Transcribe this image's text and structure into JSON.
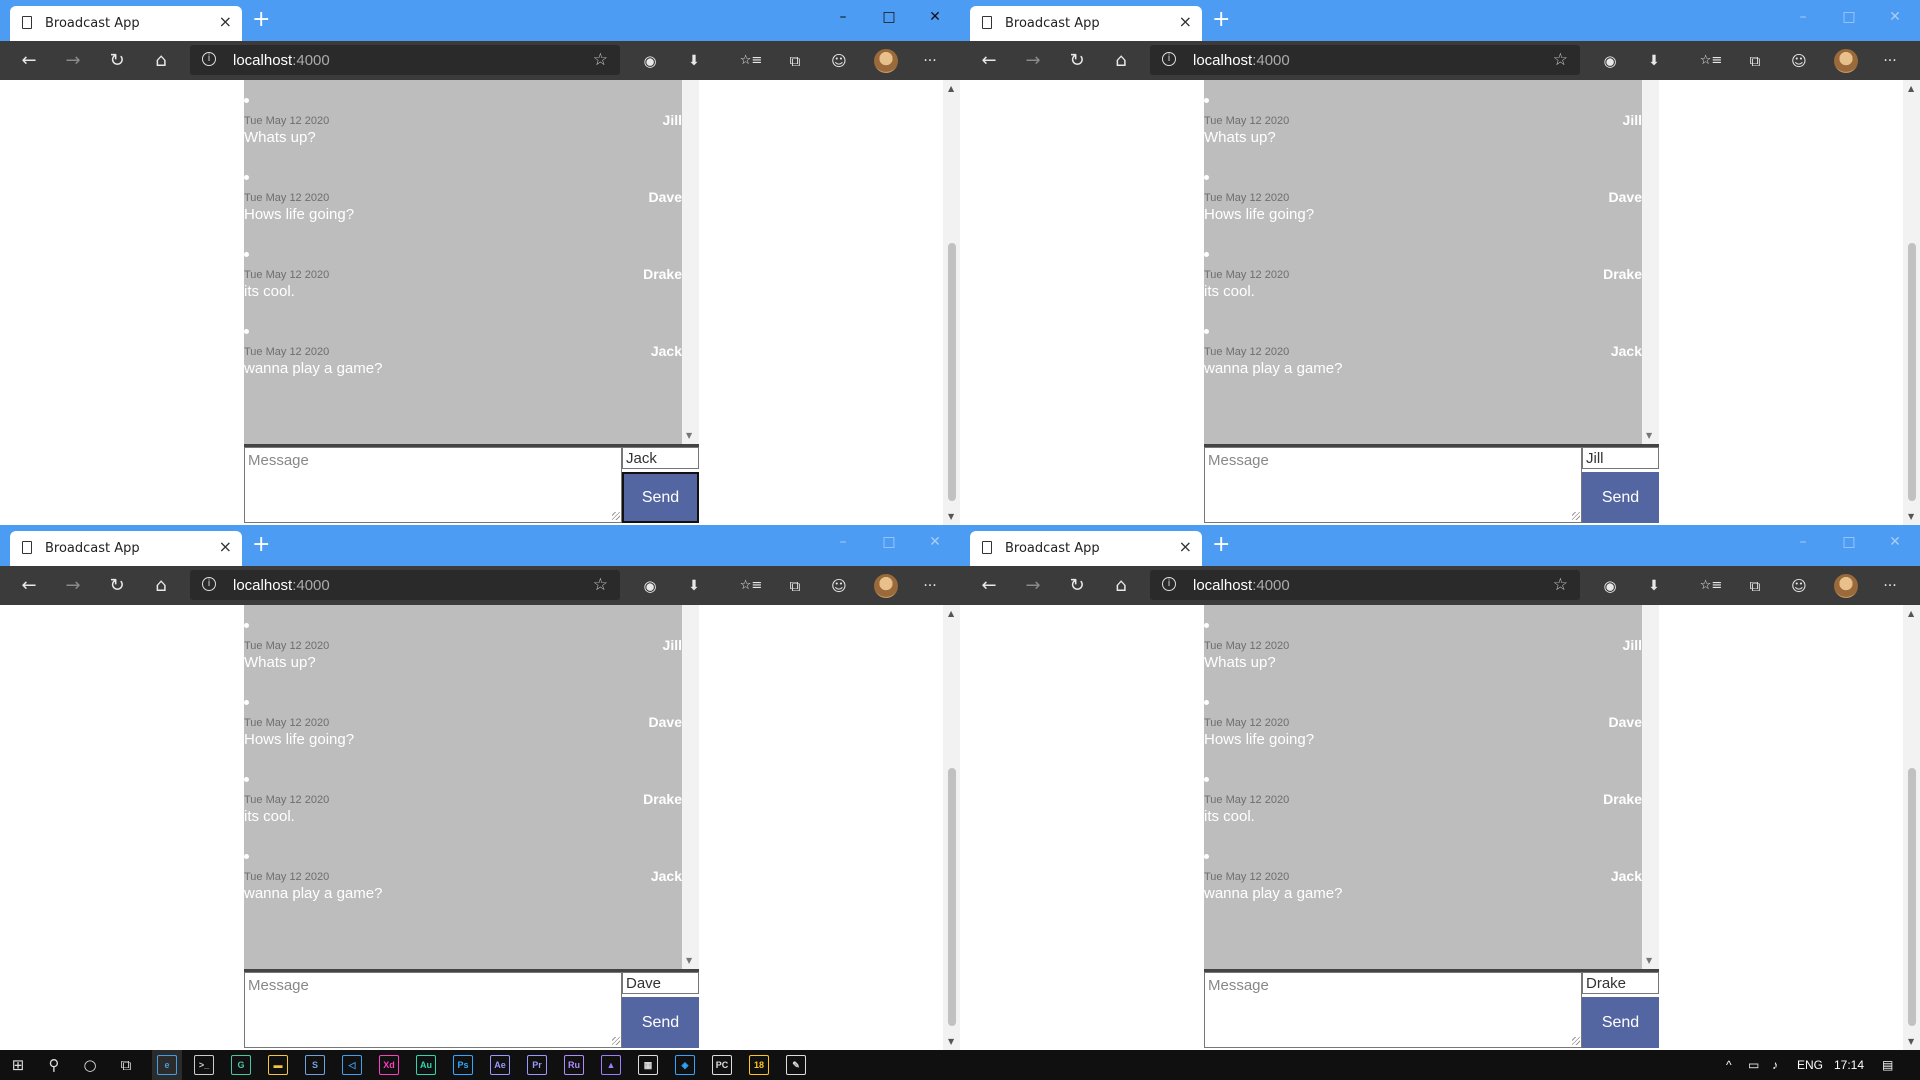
{
  "browser": {
    "tab_title": "Broadcast App",
    "tab_close": "×",
    "new_tab": "+",
    "url_host": "localhost",
    "url_port": ":4000",
    "controls": {
      "minimize": "–",
      "maximize": "□",
      "close": "✕"
    },
    "nav": {
      "back": "←",
      "forward": "→",
      "refresh": "↻",
      "home": "⌂"
    },
    "toolbar_icons": {
      "info": "i",
      "favorite": "☆",
      "record": "◉",
      "download": "⬇",
      "favorites": "☆≡",
      "collections": "⧉",
      "feedback": "☺",
      "more": "···"
    }
  },
  "scroll": {
    "up": "▲",
    "down": "▼"
  },
  "messages": [
    {
      "date": "Tue May 12 2020",
      "user": "Jill",
      "text": "Whats up?"
    },
    {
      "date": "Tue May 12 2020",
      "user": "Dave",
      "text": "Hows life going?"
    },
    {
      "date": "Tue May 12 2020",
      "user": "Drake",
      "text": "its cool."
    },
    {
      "date": "Tue May 12 2020",
      "user": "Jack",
      "text": "wanna play a game?"
    }
  ],
  "compose": {
    "message_placeholder": "Message",
    "send_label": "Send"
  },
  "windows": [
    {
      "active": true,
      "username": "Jack"
    },
    {
      "active": false,
      "username": "Jill"
    },
    {
      "active": false,
      "username": "Dave"
    },
    {
      "active": false,
      "username": "Drake"
    }
  ],
  "taskbar": {
    "start": "⊞",
    "search": "⚲",
    "cortana": "○",
    "task_view": "⧉",
    "apps": [
      {
        "name": "edge",
        "label": "e",
        "color": "#3fa0e8"
      },
      {
        "name": "terminal",
        "label": ">_",
        "color": "#cccccc"
      },
      {
        "name": "gitkraken",
        "label": "G",
        "color": "#49c6a2"
      },
      {
        "name": "file-explorer",
        "label": "▬",
        "color": "#f4c542"
      },
      {
        "name": "sourcetree",
        "label": "S",
        "color": "#6fa3e0"
      },
      {
        "name": "vscode",
        "label": "◁",
        "color": "#3da0f0"
      },
      {
        "name": "xd",
        "label": "Xd",
        "color": "#ff3ec2"
      },
      {
        "name": "audition",
        "label": "Au",
        "color": "#2fd7b0"
      },
      {
        "name": "photoshop",
        "label": "Ps",
        "color": "#31a8ff"
      },
      {
        "name": "after-effects",
        "label": "Ae",
        "color": "#9999ff"
      },
      {
        "name": "premiere",
        "label": "Pr",
        "color": "#9999ff"
      },
      {
        "name": "rush",
        "label": "Ru",
        "color": "#b08cff"
      },
      {
        "name": "visual-studio",
        "label": "▲",
        "color": "#a07cff"
      },
      {
        "name": "calculator",
        "label": "▦",
        "color": "#dddddd"
      },
      {
        "name": "vpn",
        "label": "◈",
        "color": "#2ea6ff"
      },
      {
        "name": "jetbrains",
        "label": "PC",
        "color": "#dddddd"
      },
      {
        "name": "app-18",
        "label": "18",
        "color": "#ffc51e"
      },
      {
        "name": "inkscape",
        "label": "✎",
        "color": "#dddddd"
      }
    ],
    "tray_chevron": "^",
    "network": "▭",
    "volume": "♪",
    "language": "ENG",
    "time": "17:14",
    "notifications": "▤"
  },
  "colors": {
    "titlebar": "#4c9cf4",
    "toolbar": "#3b3b3b",
    "message_list_bg": "#bdbdbd",
    "send_button": "#5366a1"
  }
}
